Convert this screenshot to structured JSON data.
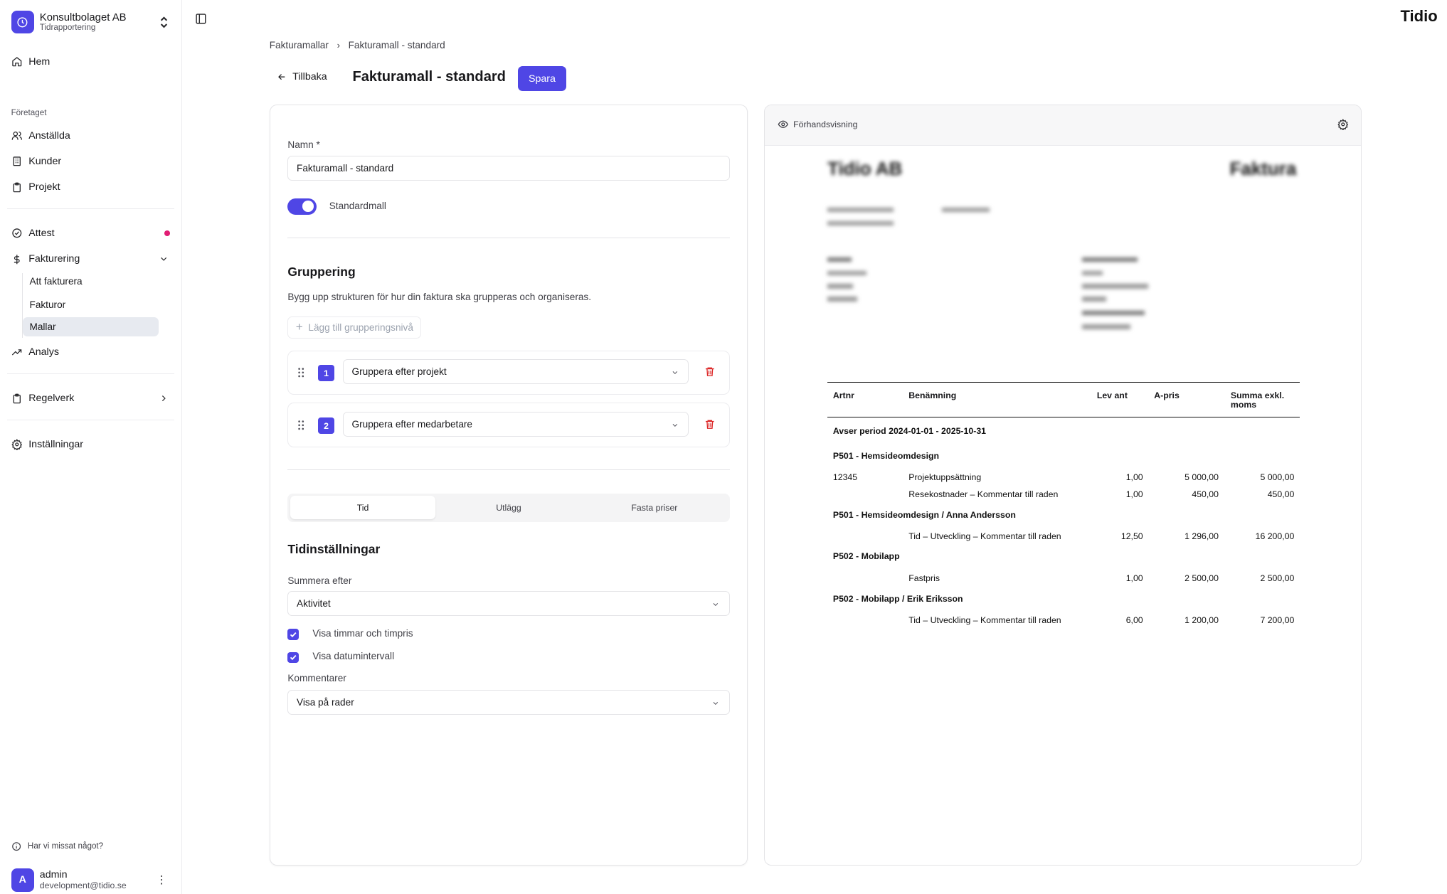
{
  "brand": "Tidio",
  "sidebar": {
    "org_name": "Konsultbolaget AB",
    "org_sub": "Tidrapportering",
    "home": "Hem",
    "section_company": "Företaget",
    "employees": "Anställda",
    "customers": "Kunder",
    "projects": "Projekt",
    "attest": "Attest",
    "billing": "Fakturering",
    "billing_sub": [
      "Att fakturera",
      "Fakturor",
      "Mallar"
    ],
    "analysis": "Analys",
    "rules": "Regelverk",
    "settings": "Inställningar",
    "help": "Har vi missat något?",
    "user_initial": "A",
    "user_name": "admin",
    "user_email": "development@tidio.se"
  },
  "breadcrumb": [
    "Fakturamallar",
    "Fakturamall - standard"
  ],
  "header": {
    "back": "Tillbaka",
    "title": "Fakturamall - standard",
    "save": "Spara"
  },
  "form": {
    "name_label": "Namn *",
    "name_value": "Fakturamall - standard",
    "default_label": "Standardmall",
    "default_on": true,
    "grouping_title": "Gruppering",
    "grouping_desc": "Bygg upp strukturen för hur din faktura ska grupperas och organiseras.",
    "add_level": "Lägg till grupperingsnivå",
    "groups": [
      {
        "num": "1",
        "value": "Gruppera efter projekt"
      },
      {
        "num": "2",
        "value": "Gruppera efter medarbetare"
      }
    ],
    "tabs": [
      "Tid",
      "Utlägg",
      "Fasta priser"
    ],
    "active_tab": "Tid",
    "time_title": "Tidinställningar",
    "sum_label": "Summera efter",
    "sum_value": "Aktivitet",
    "check_hours": "Visa timmar och timpris",
    "check_dates": "Visa datumintervall",
    "comments_label": "Kommentarer",
    "comments_value": "Visa på rader"
  },
  "preview": {
    "title": "Förhandsvisning",
    "company": "Tidio AB",
    "doc_type": "Faktura",
    "columns": [
      "Artnr",
      "Benämning",
      "Lev ant",
      "A-pris",
      "Summa exkl. moms"
    ],
    "period": "Avser period 2024-01-01 - 2025-10-31",
    "groups": [
      {
        "header": "P501 - Hemsideomdesign",
        "rows": [
          {
            "artnr": "12345",
            "desc": "Projektuppsättning",
            "qty": "1,00",
            "price": "5 000,00",
            "sum": "5 000,00"
          },
          {
            "artnr": "",
            "desc": "Resekostnader – Kommentar till raden",
            "qty": "1,00",
            "price": "450,00",
            "sum": "450,00"
          }
        ]
      },
      {
        "header": "P501 - Hemsideomdesign / Anna Andersson",
        "rows": [
          {
            "artnr": "",
            "desc": "Tid – Utveckling – Kommentar till raden",
            "qty": "12,50",
            "price": "1 296,00",
            "sum": "16 200,00"
          }
        ]
      },
      {
        "header": "P502 - Mobilapp",
        "rows": [
          {
            "artnr": "",
            "desc": "Fastpris",
            "qty": "1,00",
            "price": "2 500,00",
            "sum": "2 500,00"
          }
        ]
      },
      {
        "header": "P502 - Mobilapp / Erik Eriksson",
        "rows": [
          {
            "artnr": "",
            "desc": "Tid – Utveckling – Kommentar till raden",
            "qty": "6,00",
            "price": "1 200,00",
            "sum": "7 200,00"
          }
        ]
      }
    ]
  }
}
